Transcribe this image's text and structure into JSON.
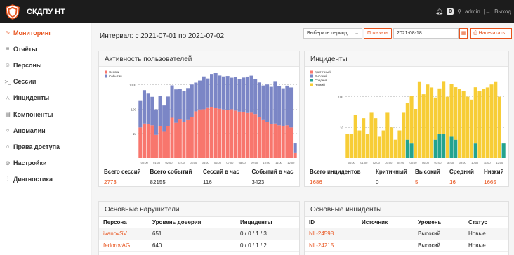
{
  "app": {
    "title": "СКДПУ НТ"
  },
  "topbar": {
    "notif_count": "0",
    "user": "admin",
    "logout": "Выход"
  },
  "sidebar": {
    "items": [
      {
        "label": "Мониторинг",
        "icon": "pulse-icon"
      },
      {
        "label": "Отчёты",
        "icon": "list-icon"
      },
      {
        "label": "Персоны",
        "icon": "users-icon"
      },
      {
        "label": "Сессии",
        "icon": "terminal-icon"
      },
      {
        "label": "Инциденты",
        "icon": "warning-icon"
      },
      {
        "label": "Компоненты",
        "icon": "server-icon"
      },
      {
        "label": "Аномалии",
        "icon": "circle-icon"
      },
      {
        "label": "Права доступа",
        "icon": "lock-icon"
      },
      {
        "label": "Настройки",
        "icon": "gear-icon"
      },
      {
        "label": "Диагностика",
        "icon": "chart-icon"
      }
    ]
  },
  "toolbar": {
    "interval": "Интервал: с 2021-07-01 по 2021-07-02",
    "period_placeholder": "Выберите период...",
    "show_label": "Показать",
    "date_value": "2021-08-18",
    "print_label": "Напечатать"
  },
  "activity": {
    "title": "Активность пользователей",
    "stats_headers": [
      "Всего сессий",
      "Всего событий",
      "Сессий в час",
      "Событий в час"
    ],
    "stats_values": [
      "2773",
      "82155",
      "116",
      "3423"
    ]
  },
  "incidents": {
    "title": "Инциденты",
    "stats_headers": [
      "Всего инцидентов",
      "Критичный",
      "Высокий",
      "Средний",
      "Низкий"
    ],
    "stats_values": [
      "1686",
      "0",
      "5",
      "16",
      "1665"
    ]
  },
  "violators": {
    "title": "Основные нарушители",
    "headers": [
      "Персона",
      "Уровень доверия",
      "Инциденты"
    ],
    "rows": [
      [
        "ivanovSV",
        "651",
        "0 / 0 / 1 / 3"
      ],
      [
        "fedorovAG",
        "640",
        "0 / 0 / 1 / 2"
      ]
    ]
  },
  "main_incidents": {
    "title": "Основные инциденты",
    "headers": [
      "ID",
      "Источник",
      "Уровень",
      "Статус"
    ],
    "rows": [
      [
        "NL-24598",
        "",
        "Высокий",
        "Новые"
      ],
      [
        "NL-24215",
        "",
        "Высокий",
        "Новые"
      ]
    ]
  },
  "chart_data": [
    {
      "type": "bar",
      "stacked": true,
      "yscale": "log",
      "legend": [
        "Сессии",
        "События"
      ],
      "legend_position": "top-left",
      "colors": [
        "#f8766d",
        "#7b86c6"
      ],
      "ytick_labels": [
        "1000",
        "100",
        "10"
      ],
      "xtick_labels": [
        "00:00",
        "01:00",
        "02:00",
        "03:00",
        "04:00",
        "05:00",
        "06:00",
        "07:00",
        "08:00",
        "09:00",
        "10:00",
        "11:00",
        "12:00"
      ],
      "series": [
        {
          "name": "Сессии",
          "values": [
            18,
            26,
            24,
            22,
            9,
            20,
            12,
            20,
            45,
            28,
            38,
            30,
            36,
            48,
            82,
            98,
            100,
            112,
            120,
            110,
            104,
            98,
            96,
            100,
            88,
            80,
            76,
            70,
            72,
            64,
            48,
            36,
            30,
            24,
            26,
            22,
            20,
            22,
            18,
            1.6
          ]
        },
        {
          "name": "События",
          "values": [
            200,
            580,
            410,
            300,
            90,
            330,
            130,
            310,
            900,
            620,
            640,
            520,
            700,
            980,
            1150,
            1400,
            2100,
            1700,
            2500,
            2900,
            2300,
            2100,
            2200,
            1850,
            2000,
            1600,
            1900,
            2100,
            2300,
            1700,
            1200,
            900,
            1000,
            800,
            1300,
            850,
            700,
            900,
            760,
            2.4
          ]
        }
      ]
    },
    {
      "type": "bar",
      "stacked": true,
      "yscale": "log",
      "legend": [
        "Критичный",
        "Высокий",
        "Средний",
        "Низкий"
      ],
      "legend_position": "top-left",
      "colors": [
        "#f8766d",
        "#7b86c6",
        "#23a38f",
        "#f7cd36"
      ],
      "ytick_labels": [
        "100",
        "10"
      ],
      "xtick_labels": [
        "00:00",
        "01:00",
        "02:00",
        "03:00",
        "04:00",
        "05:00",
        "06:00",
        "07:00",
        "08:00",
        "09:00",
        "10:00",
        "11:00",
        "12:00"
      ],
      "series": [
        {
          "name": "Средний",
          "values": [
            0,
            0,
            0,
            0,
            0,
            0,
            0,
            0,
            0,
            0,
            0,
            0,
            0,
            0,
            0,
            4,
            3,
            0,
            0,
            0,
            0,
            0,
            4,
            6,
            6,
            0,
            5,
            4,
            0,
            0,
            0,
            0,
            3,
            0,
            0,
            0,
            0,
            0,
            0,
            3
          ]
        },
        {
          "name": "Низкий",
          "values": [
            6,
            6,
            25,
            8,
            20,
            6,
            30,
            20,
            5,
            8,
            30,
            10,
            4,
            8,
            30,
            60,
            100,
            40,
            300,
            120,
            250,
            200,
            90,
            180,
            300,
            100,
            250,
            200,
            180,
            150,
            100,
            80,
            200,
            150,
            180,
            200,
            250,
            300,
            100,
            0
          ]
        }
      ]
    }
  ]
}
